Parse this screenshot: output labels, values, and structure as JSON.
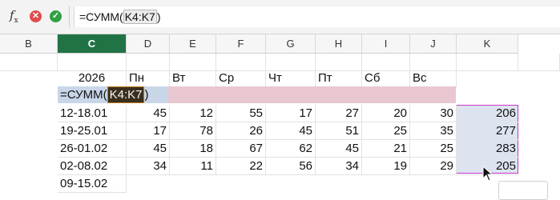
{
  "formula_bar": {
    "fx_label": "f",
    "fx_sub": "x",
    "cancel_glyph": "✕",
    "confirm_glyph": "✓",
    "formula_prefix": "=СУММ(",
    "formula_ref": "K4:K7",
    "formula_suffix": ")"
  },
  "columns": [
    {
      "label": "B",
      "active": false
    },
    {
      "label": "C",
      "active": true
    },
    {
      "label": "D",
      "active": false
    },
    {
      "label": "E",
      "active": false
    },
    {
      "label": "F",
      "active": false
    },
    {
      "label": "G",
      "active": false
    },
    {
      "label": "H",
      "active": false
    },
    {
      "label": "I",
      "active": false
    },
    {
      "label": "J",
      "active": false
    },
    {
      "label": "K",
      "active": false
    }
  ],
  "sheet": {
    "year": "2026",
    "weekdays": [
      "Пн",
      "Вт",
      "Ср",
      "Чт",
      "Пт",
      "Сб",
      "Вс"
    ],
    "editing_cell": {
      "prefix": "=СУММ(",
      "ref": "K4:K7",
      "suffix": ")"
    },
    "rows": [
      {
        "week": "12-18.01",
        "values": [
          "45",
          "12",
          "55",
          "17",
          "27",
          "20",
          "30"
        ],
        "sum": "206"
      },
      {
        "week": "19-25.01",
        "values": [
          "17",
          "78",
          "26",
          "45",
          "51",
          "25",
          "35"
        ],
        "sum": "277"
      },
      {
        "week": "26-01.02",
        "values": [
          "45",
          "18",
          "67",
          "62",
          "45",
          "21",
          "25"
        ],
        "sum": "283"
      },
      {
        "week": "02-08.02",
        "values": [
          "34",
          "11",
          "22",
          "56",
          "34",
          "19",
          "29"
        ],
        "sum": "205"
      }
    ],
    "last_week": "09-15.02"
  },
  "colors": {
    "active_column": "#217346",
    "selection_border": "#cc33cc",
    "selection_fill": "#dde4f0",
    "pink_band": "#e8c7d0",
    "edit_cell": "#c8d6e8"
  }
}
